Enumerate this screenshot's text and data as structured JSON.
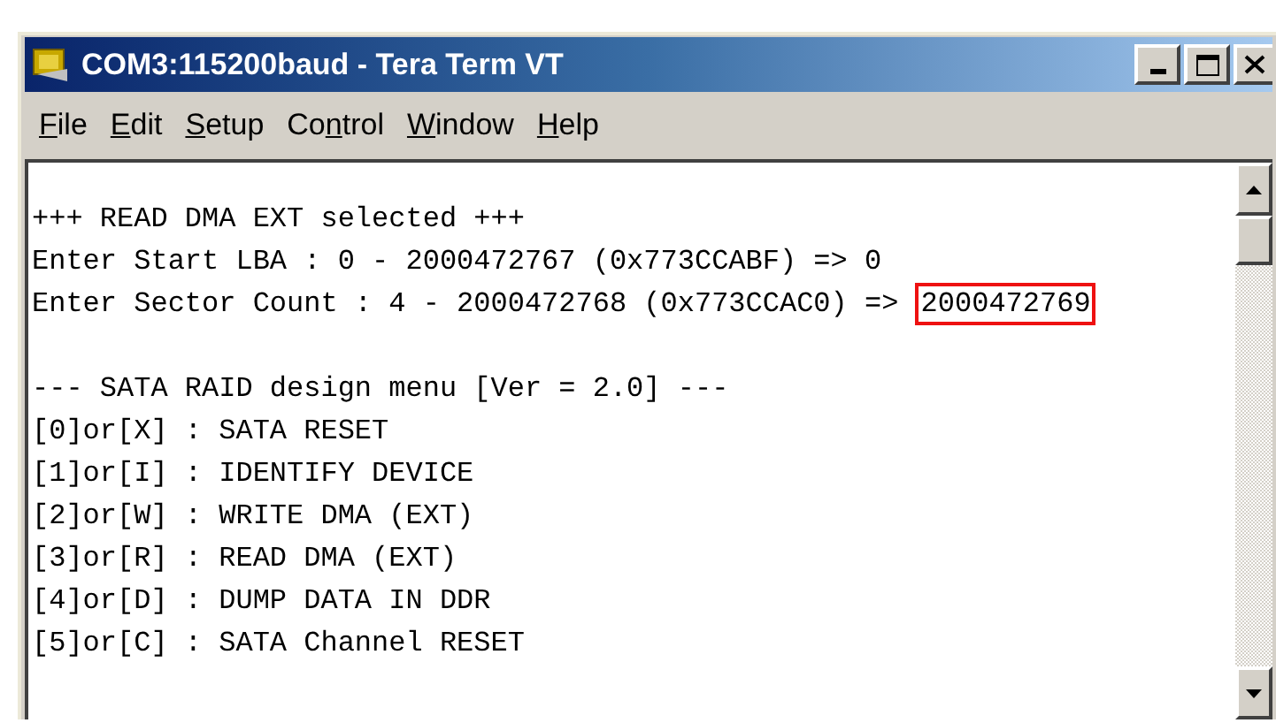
{
  "window": {
    "title": "COM3:115200baud - Tera Term VT"
  },
  "menu": [
    {
      "parts": [
        {
          "text": "F",
          "underlined": true
        },
        {
          "text": "ile",
          "underlined": false
        }
      ]
    },
    {
      "parts": [
        {
          "text": "E",
          "underlined": true
        },
        {
          "text": "dit",
          "underlined": false
        }
      ]
    },
    {
      "parts": [
        {
          "text": "S",
          "underlined": true
        },
        {
          "text": "etup",
          "underlined": false
        }
      ]
    },
    {
      "parts": [
        {
          "text": "Co",
          "underlined": false
        },
        {
          "text": "n",
          "underlined": true
        },
        {
          "text": "trol",
          "underlined": false
        }
      ]
    },
    {
      "parts": [
        {
          "text": "W",
          "underlined": true
        },
        {
          "text": "indow",
          "underlined": false
        }
      ]
    },
    {
      "parts": [
        {
          "text": "H",
          "underlined": true
        },
        {
          "text": "elp",
          "underlined": false
        }
      ]
    }
  ],
  "terminal": {
    "blocks": [
      {
        "lines": [
          {
            "text": "+++ READ DMA EXT selected +++"
          },
          {
            "text": "Enter Start LBA : 0 - 2000472767 (0x773CCABF) => ",
            "input": "0",
            "boxed": false
          },
          {
            "text": "Enter Sector Count : 4 - 2000472768 (0x773CCAC0) => ",
            "input": "2000472769",
            "boxed": true
          }
        ]
      },
      {
        "lines": [
          {
            "text": "--- SATA RAID design menu [Ver = 2.0] ---"
          },
          {
            "text": "[0]or[X] : SATA RESET"
          },
          {
            "text": "[1]or[I] : IDENTIFY DEVICE"
          },
          {
            "text": "[2]or[W] : WRITE DMA (EXT)"
          },
          {
            "text": "[3]or[R] : READ DMA (EXT)"
          },
          {
            "text": "[4]or[D] : DUMP DATA IN DDR"
          },
          {
            "text": "[5]or[C] : SATA Channel RESET"
          }
        ]
      }
    ]
  }
}
